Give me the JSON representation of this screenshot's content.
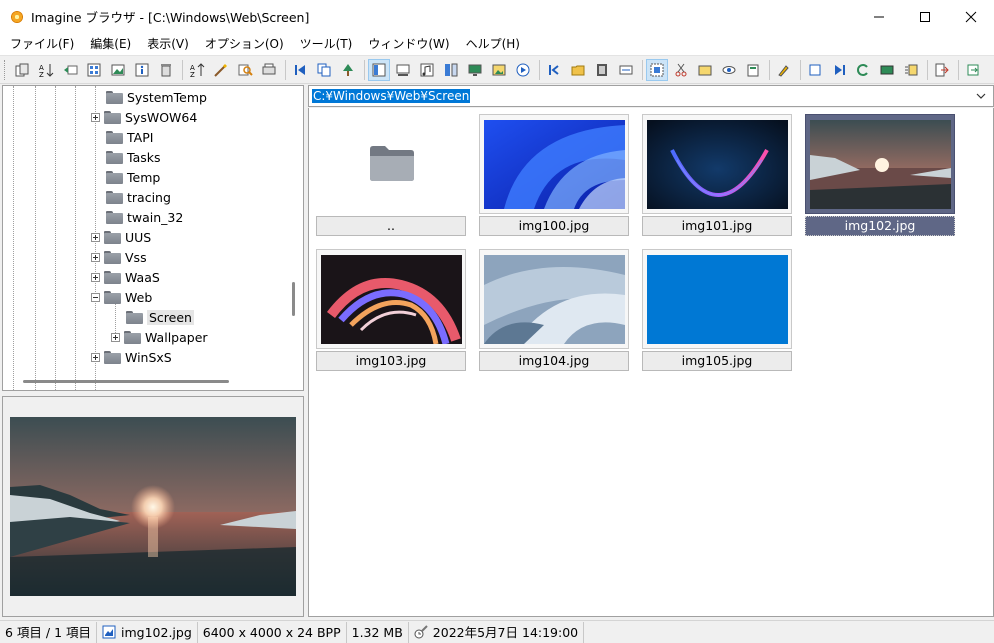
{
  "window": {
    "title": "Imagine ブラウザ - [C:\\Windows\\Web\\Screen]"
  },
  "menu": [
    {
      "label": "ファイル(F)"
    },
    {
      "label": "編集(E)"
    },
    {
      "label": "表示(V)"
    },
    {
      "label": "オプション(O)"
    },
    {
      "label": "ツール(T)"
    },
    {
      "label": "ウィンドウ(W)"
    },
    {
      "label": "ヘルプ(H)"
    }
  ],
  "tree": {
    "items": [
      {
        "label": "SystemTemp",
        "expander": "none",
        "level": 1
      },
      {
        "label": "SysWOW64",
        "expander": "plus",
        "level": 1
      },
      {
        "label": "TAPI",
        "expander": "none",
        "level": 1
      },
      {
        "label": "Tasks",
        "expander": "none",
        "level": 1
      },
      {
        "label": "Temp",
        "expander": "none",
        "level": 1
      },
      {
        "label": "tracing",
        "expander": "none",
        "level": 1
      },
      {
        "label": "twain_32",
        "expander": "none",
        "level": 1
      },
      {
        "label": "UUS",
        "expander": "plus",
        "level": 1
      },
      {
        "label": "Vss",
        "expander": "plus",
        "level": 1
      },
      {
        "label": "WaaS",
        "expander": "plus",
        "level": 1
      },
      {
        "label": "Web",
        "expander": "minus",
        "level": 1
      },
      {
        "label": "Screen",
        "expander": "none",
        "level": 2,
        "selected": true
      },
      {
        "label": "Wallpaper",
        "expander": "plus",
        "level": 2
      },
      {
        "label": "WinSxS",
        "expander": "plus",
        "level": 1
      }
    ]
  },
  "path": {
    "value": "C:¥Windows¥Web¥Screen"
  },
  "thumbnails": [
    {
      "label": "..",
      "kind": "folder"
    },
    {
      "label": "img100.jpg",
      "kind": "blue-ribbon"
    },
    {
      "label": "img101.jpg",
      "kind": "dark-sphere"
    },
    {
      "label": "img102.jpg",
      "kind": "sunset",
      "selected": true
    },
    {
      "label": "img103.jpg",
      "kind": "swirl"
    },
    {
      "label": "img104.jpg",
      "kind": "grey-ribbon"
    },
    {
      "label": "img105.jpg",
      "kind": "solid-blue"
    }
  ],
  "status": {
    "count": "6 項目 / 1 項目",
    "file": "img102.jpg",
    "dimensions": "6400 x 4000 x 24 BPP",
    "size": "1.32 MB",
    "date": "2022年5月7日 14:19:00"
  },
  "colors": {
    "selection": "#5f6786",
    "path_highlight": "#0078d7"
  }
}
